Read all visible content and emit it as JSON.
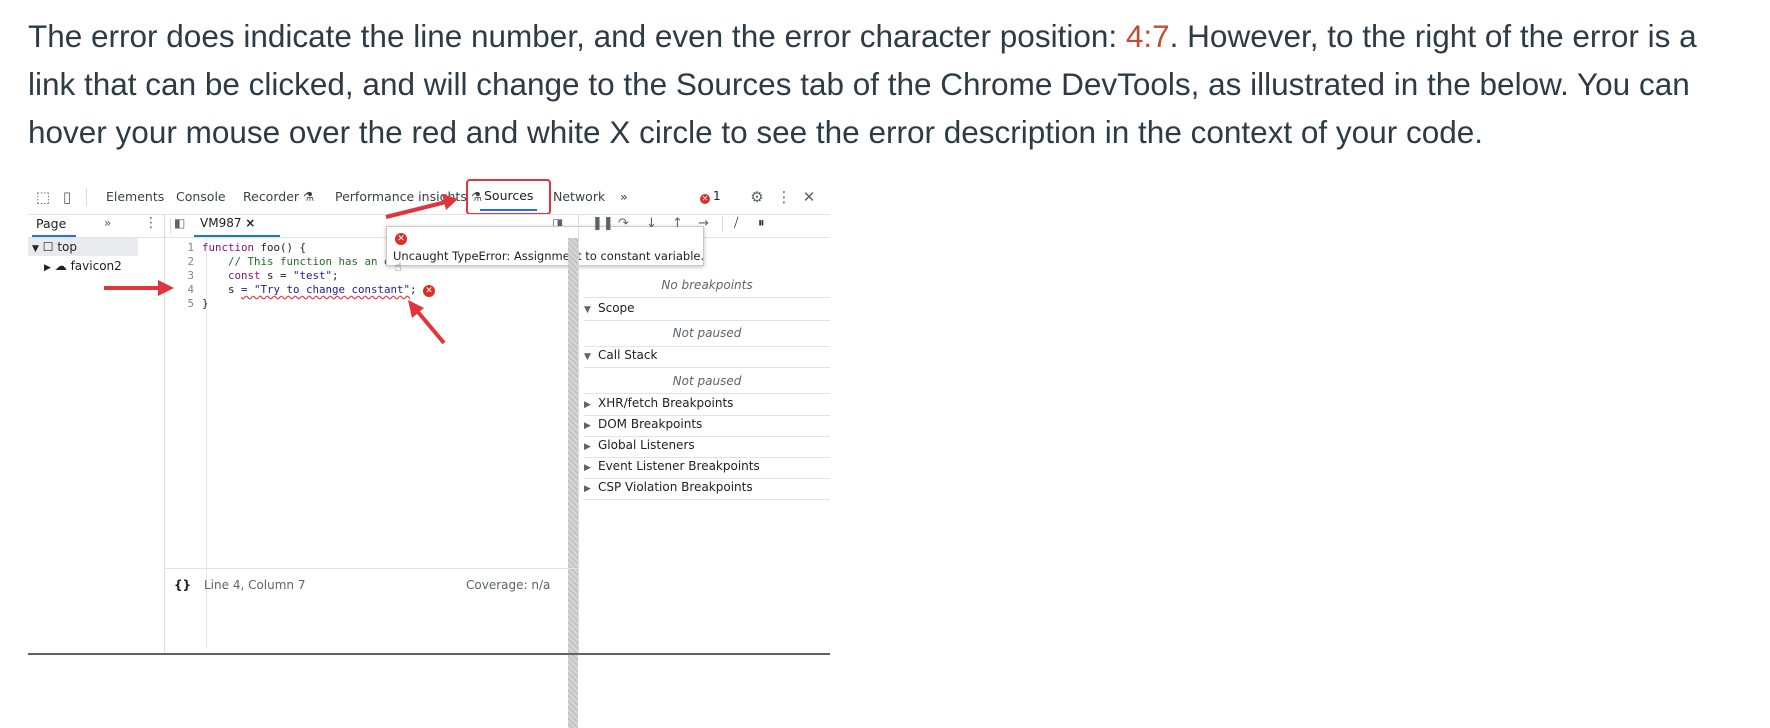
{
  "paragraph": {
    "before": "The error does indicate the line number, and even the error character position: ",
    "link": "4:7",
    "after": ". However, to the right of the error is a link that can be clicked, and will change to the Sources tab of the Chrome DevTools, as illustrated in the below. You can hover your mouse over the red and white X circle to see the error description in the context of your code."
  },
  "devtools": {
    "tabs": [
      "Elements",
      "Console",
      "Recorder",
      "Performance insights",
      "Sources",
      "Network"
    ],
    "more_tabs": "»",
    "error_count": "1",
    "navigator": {
      "tab": "Page",
      "more": "»",
      "tree": [
        {
          "label": "top"
        },
        {
          "label": "favicon2"
        }
      ]
    },
    "editor": {
      "file_tab": "VM987",
      "close": "×",
      "lines": [
        {
          "num": "1",
          "kw": "function",
          "rest": " foo() {"
        },
        {
          "num": "2",
          "comment": "    // This function has an erro"
        },
        {
          "num": "3",
          "kw": "    const",
          "rest": " s = ",
          "str": "\"test\"",
          "end": ";"
        },
        {
          "num": "4",
          "pre": "    s ",
          "err": "= \"Try to change constant\"",
          "end": ";"
        },
        {
          "num": "5",
          "rest": "}"
        }
      ],
      "tooltip": "Uncaught TypeError: Assignment to constant variable.",
      "status_left": "{}",
      "status_pos": "Line 4, Column 7",
      "status_right": "Coverage: n/a"
    },
    "debugger": {
      "no_breakpoints": "No breakpoints",
      "scope": "Scope",
      "scope_note": "Not paused",
      "call_stack": "Call Stack",
      "call_note": "Not paused",
      "sections": [
        "XHR/fetch Breakpoints",
        "DOM Breakpoints",
        "Global Listeners",
        "Event Listener Breakpoints",
        "CSP Violation Breakpoints"
      ]
    }
  },
  "colors": {
    "link": "#c44c32",
    "error": "#d93025",
    "active_tab": "#1a73e8",
    "annotation": "#e0353a"
  }
}
